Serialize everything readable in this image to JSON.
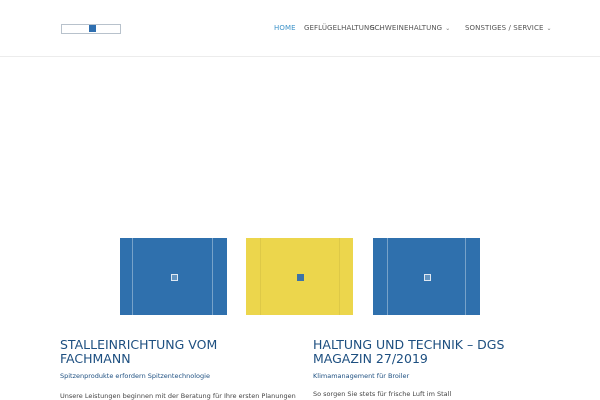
{
  "colors": {
    "accent": "#3e93c9",
    "heading": "#1d4f80",
    "tile_blue": "#2f70ad",
    "tile_yellow": "#ecd64c"
  },
  "nav": {
    "items": [
      {
        "label": "HOME",
        "active": true,
        "has_dropdown": false
      },
      {
        "label": "GEFLÜGELHALTUNG",
        "active": false,
        "has_dropdown": true
      },
      {
        "label": "SCHWEINEHALTUNG",
        "active": false,
        "has_dropdown": true
      },
      {
        "label": "SONSTIGES / SERVICE",
        "active": false,
        "has_dropdown": true
      }
    ],
    "caret": "⌄"
  },
  "tiles": [
    {
      "color": "#2f70ad",
      "icon": "image-placeholder-icon"
    },
    {
      "color": "#ecd64c",
      "icon": "image-placeholder-icon"
    },
    {
      "color": "#2f70ad",
      "icon": "image-placeholder-icon"
    }
  ],
  "columns": [
    {
      "title": "STALLEINRICHTUNG VOM FACHMANN",
      "subtitle": "Spitzenprodukte erfordern Spitzentechnologie",
      "body": "Unsere Leistungen beginnen mit der Beratung für Ihre ersten Planungen"
    },
    {
      "title": "HALTUNG UND TECHNIK – DGS MAGAZIN 27/2019",
      "subtitle": "Klimamanagement für Broiler",
      "body": "So sorgen Sie stets für frische Luft im Stall"
    }
  ]
}
